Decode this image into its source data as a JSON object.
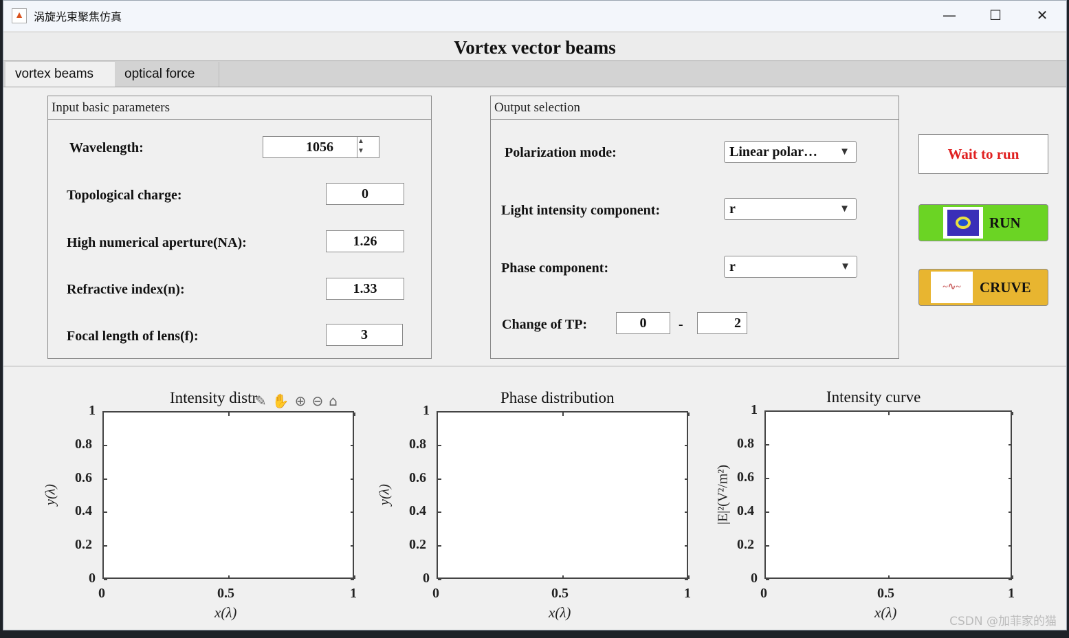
{
  "window": {
    "title": "涡旋光束聚焦仿真",
    "minimize": "—",
    "maximize": "☐",
    "close": "✕"
  },
  "header": {
    "title": "Vortex vector beams"
  },
  "tabs": [
    {
      "label": "vortex beams",
      "active": true
    },
    {
      "label": "optical force",
      "active": false
    }
  ],
  "input_panel": {
    "title": "Input basic parameters",
    "wavelength": {
      "label": "Wavelength:",
      "value": "1056"
    },
    "topological_charge": {
      "label": "Topological charge:",
      "value": "0"
    },
    "na": {
      "label": "High numerical aperture(NA):",
      "value": "1.26"
    },
    "refractive_index": {
      "label": "Refractive index(n):",
      "value": "1.33"
    },
    "focal_length": {
      "label": "Focal length of lens(f):",
      "value": "3"
    }
  },
  "output_panel": {
    "title": "Output selection",
    "polarization": {
      "label": "Polarization mode:",
      "value": "Linear polar…"
    },
    "intensity_component": {
      "label": "Light intensity component:",
      "value": "r"
    },
    "phase_component": {
      "label": "Phase component:",
      "value": "r"
    },
    "change_tp": {
      "label": "Change of TP:",
      "from": "0",
      "sep": "-",
      "to": "2"
    }
  },
  "status": {
    "text": "Wait to run",
    "color": "#e02020"
  },
  "buttons": {
    "run": "RUN",
    "run_color": "#6bd424",
    "cruve": "CRUVE",
    "cruve_color": "#e8b530"
  },
  "plot_toolbar": {
    "icons": [
      "brush-icon",
      "pan-icon",
      "zoom-in-icon",
      "zoom-out-icon",
      "home-icon"
    ]
  },
  "chart_data": [
    {
      "type": "line",
      "title": "Intensity distr",
      "xlabel": "x(λ)",
      "ylabel": "y(λ)",
      "xlim": [
        0,
        1
      ],
      "ylim": [
        0,
        1
      ],
      "xticks": [
        "0",
        "0.5",
        "1"
      ],
      "yticks": [
        "0",
        "0.2",
        "0.4",
        "0.6",
        "0.8",
        "1"
      ],
      "series": []
    },
    {
      "type": "line",
      "title": "Phase distribution",
      "xlabel": "x(λ)",
      "ylabel": "y(λ)",
      "xlim": [
        0,
        1
      ],
      "ylim": [
        0,
        1
      ],
      "xticks": [
        "0",
        "0.5",
        "1"
      ],
      "yticks": [
        "0",
        "0.2",
        "0.4",
        "0.6",
        "0.8",
        "1"
      ],
      "series": []
    },
    {
      "type": "line",
      "title": "Intensity curve",
      "xlabel": "x(λ)",
      "ylabel": "|E|²(V²/m²)",
      "xlim": [
        0,
        1
      ],
      "ylim": [
        0,
        1
      ],
      "xticks": [
        "0",
        "0.5",
        "1"
      ],
      "yticks": [
        "0",
        "0.2",
        "0.4",
        "0.6",
        "0.8",
        "1"
      ],
      "series": []
    }
  ],
  "watermark": "CSDN @加菲家的猫"
}
